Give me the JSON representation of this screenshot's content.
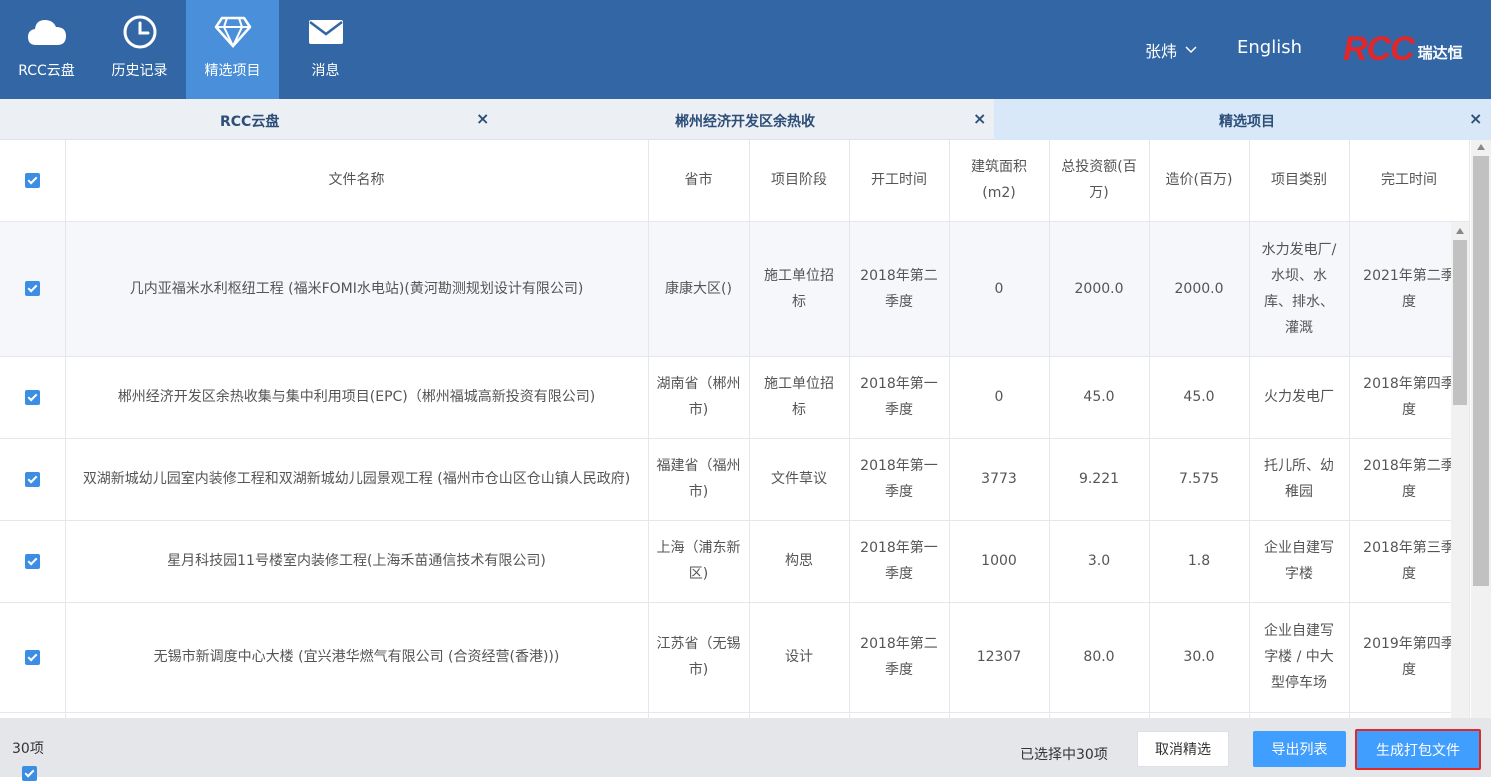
{
  "nav": {
    "items": [
      {
        "label": "RCC云盘",
        "icon": "cloud-icon"
      },
      {
        "label": "历史记录",
        "icon": "clock-icon"
      },
      {
        "label": "精选项目",
        "icon": "diamond-icon",
        "active": true
      },
      {
        "label": "消息",
        "icon": "mail-icon"
      }
    ],
    "user": "张炜",
    "language": "English",
    "logo_text": "RCC",
    "logo_cn": "瑞达恒"
  },
  "tabs": [
    {
      "label": "RCC云盘",
      "close": "×"
    },
    {
      "label": "郴州经济开发区余热收",
      "close": "×"
    },
    {
      "label": "精选项目",
      "close": "×",
      "active": true
    }
  ],
  "table": {
    "headers": [
      "文件名称",
      "省市",
      "项目阶段",
      "开工时间",
      "建筑面积(m2)",
      "总投资额(百万)",
      "造价(百万)",
      "项目类别",
      "完工时间"
    ],
    "rows": [
      {
        "name": "几内亚福米水利枢纽工程 (福米FOMI水电站)(黄河勘测规划设计有限公司)",
        "region": "康康大区()",
        "stage": "施工单位招标",
        "start": "2018年第二季度",
        "area": "0",
        "invest": "2000.0",
        "cost": "2000.0",
        "category": "水力发电厂/水坝、水库、排水、灌溉",
        "finish": "2021年第二季度"
      },
      {
        "name": "郴州经济开发区余热收集与集中利用项目(EPC)（郴州福城高新投资有限公司)",
        "region": "湖南省（郴州市)",
        "stage": "施工单位招标",
        "start": "2018年第一季度",
        "area": "0",
        "invest": "45.0",
        "cost": "45.0",
        "category": "火力发电厂",
        "finish": "2018年第四季度"
      },
      {
        "name": "双湖新城幼儿园室内装修工程和双湖新城幼儿园景观工程 (福州市仓山区仓山镇人民政府)",
        "region": "福建省（福州市)",
        "stage": "文件草议",
        "start": "2018年第一季度",
        "area": "3773",
        "invest": "9.221",
        "cost": "7.575",
        "category": "托儿所、幼稚园",
        "finish": "2018年第二季度"
      },
      {
        "name": "星月科技园11号楼室内装修工程(上海禾苗通信技术有限公司)",
        "region": "上海（浦东新区)",
        "stage": "构思",
        "start": "2018年第一季度",
        "area": "1000",
        "invest": "3.0",
        "cost": "1.8",
        "category": "企业自建写字楼",
        "finish": "2018年第三季度"
      },
      {
        "name": "无锡市新调度中心大楼 (宜兴港华燃气有限公司 (合资经营(香港)))",
        "region": "江苏省（无锡市)",
        "stage": "设计",
        "start": "2018年第二季度",
        "area": "12307",
        "invest": "80.0",
        "cost": "30.0",
        "category": "企业自建写字楼 / 中大型停车场",
        "finish": "2019年第四季度"
      }
    ]
  },
  "footer": {
    "count": "30项",
    "selected": "已选择中30项",
    "cancel_label": "取消精选",
    "export_label": "导出列表",
    "generate_label": "生成打包文件"
  },
  "colors": {
    "topbar": "#3266a4",
    "nav_active": "#4a8fd9",
    "primary_button": "#409eff",
    "highlight_border": "#e32727",
    "logo_red": "#e2262a"
  }
}
